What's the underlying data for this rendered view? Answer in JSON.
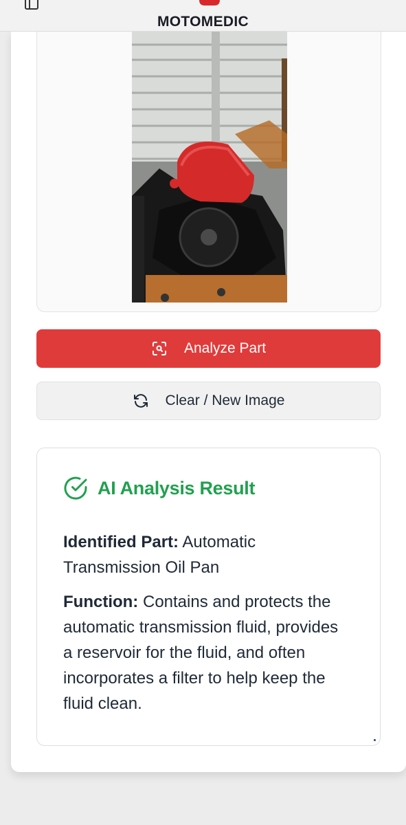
{
  "header": {
    "brand_name": "MOTOMEDIC",
    "menu_icon": "sidebar-panel-icon",
    "logo_icon": "motomedic-cross-logo",
    "accent_color": "#d8282b"
  },
  "preview": {
    "image_alt": "Photo of a red automatic transmission oil pan on an engine block"
  },
  "actions": {
    "analyze_label": "Analyze Part",
    "analyze_icon": "scan-search-icon",
    "analyze_color": "#e03b3b",
    "clear_label": "Clear / New Image",
    "clear_icon": "refresh-icon"
  },
  "result": {
    "title": "AI Analysis Result",
    "title_icon": "check-circle-icon",
    "title_color": "#22a04f",
    "identified_label": "Identified Part:",
    "identified_value": "Automatic Transmission Oil Pan",
    "function_label": "Function:",
    "function_value": "Contains and protects the automatic transmission fluid, provides a reservoir for the fluid, and often incorporates a filter to help keep the fluid clean."
  }
}
